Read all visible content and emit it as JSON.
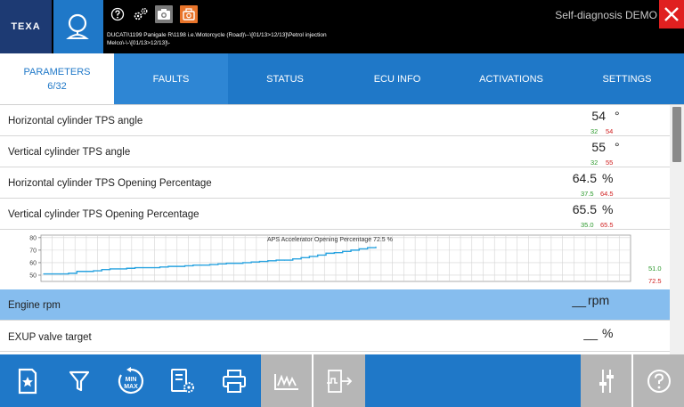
{
  "header": {
    "logo": "TEXA",
    "vehicle_line1": "DUCATI\\1199 Panigale R\\1198 i.e.\\Motorcycle (Road)\\--\\[01/13>12/13]\\Petrol injection",
    "vehicle_line2": "Melco\\-\\-\\[01/13>12/13]\\-",
    "title": "Self-diagnosis DEMO",
    "icons": [
      "diagnosis-search-icon",
      "help-icon",
      "gears-icon",
      "camera-icon",
      "camera-orange-icon",
      "close-icon"
    ]
  },
  "tabs": [
    {
      "label": "PARAMETERS",
      "count": "6/32"
    },
    {
      "label": "FAULTS"
    },
    {
      "label": "STATUS"
    },
    {
      "label": "ECU INFO"
    },
    {
      "label": "ACTIVATIONS"
    },
    {
      "label": "SETTINGS"
    }
  ],
  "params": [
    {
      "label": "Horizontal cylinder TPS angle",
      "value": "54",
      "unit": "°",
      "min": "32",
      "max": "54"
    },
    {
      "label": "Vertical cylinder TPS angle",
      "value": "55",
      "unit": "°",
      "min": "32",
      "max": "55"
    },
    {
      "label": "Horizontal cylinder TPS Opening Percentage",
      "value": "64.5",
      "unit": "%",
      "min": "37.5",
      "max": "64.5"
    },
    {
      "label": "Vertical cylinder TPS Opening Percentage",
      "value": "65.5",
      "unit": "%",
      "min": "35.0",
      "max": "65.5"
    },
    {
      "label": "Engine rpm",
      "value": "__",
      "unit": "rpm"
    },
    {
      "label": "EXUP valve target",
      "value": "__",
      "unit": "%"
    }
  ],
  "graph": {
    "title": "APS Accelerator Opening Percentage",
    "current": "72.5",
    "unit": "%",
    "min": "51.0",
    "max": "72.5",
    "yticks": [
      "80",
      "70",
      "60",
      "50"
    ]
  },
  "chart_data": {
    "type": "line",
    "title": "APS Accelerator Opening Percentage",
    "ylim": [
      45,
      82
    ],
    "yticks": [
      50,
      60,
      70,
      80
    ],
    "grid": true,
    "series": [
      {
        "values": [
          51,
          51,
          51,
          51.5,
          53,
          53,
          53.5,
          54.5,
          55,
          55,
          55.5,
          56,
          56,
          56,
          56.5,
          57,
          57,
          57.5,
          58,
          58,
          58.5,
          59,
          59.5,
          59.5,
          60,
          60.5,
          61,
          61.5,
          62,
          62,
          63,
          64,
          65,
          66,
          67.5,
          68,
          69,
          70,
          71,
          72,
          72.5
        ]
      }
    ]
  },
  "toolbar": {
    "buttons": [
      "bookmark-star-icon",
      "filter-icon",
      "min-max-icon",
      "settings-list-icon",
      "print-icon",
      "graph-icon",
      "signal-export-icon",
      "sliders-icon",
      "help-circle-icon"
    ],
    "minmax_text1": "MIN",
    "minmax_text2": "MAX"
  },
  "colors": {
    "accent": "#1f78c8",
    "selected_row": "#86bdee",
    "min_green": "#2e9a2e",
    "max_red": "#d02020",
    "close_red": "#e02020",
    "orange": "#e8742a"
  }
}
